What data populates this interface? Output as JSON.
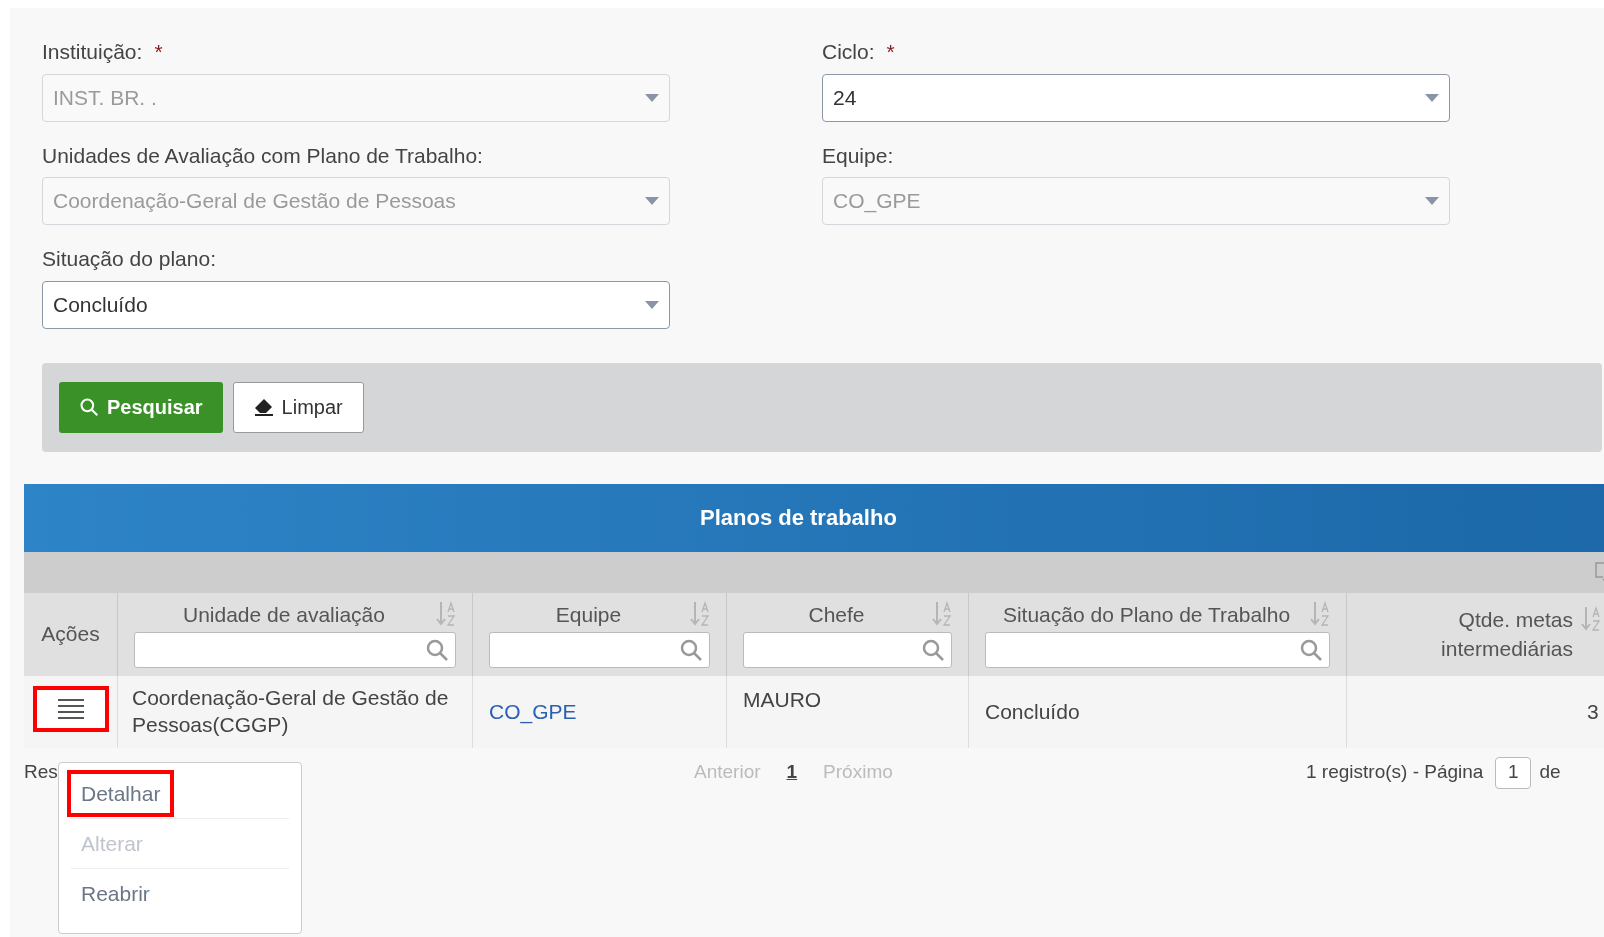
{
  "form": {
    "fields": [
      {
        "label": "Instituição:",
        "required_mark": "*",
        "value": "INST. BR. .",
        "disabled": true
      },
      {
        "label": "Ciclo:",
        "required_mark": "*",
        "value": "24",
        "disabled": false
      },
      {
        "label": "Unidades de Avaliação com Plano de Trabalho:",
        "value": "Coordenação-Geral de Gestão de Pessoas",
        "disabled": true
      },
      {
        "label": "Equipe:",
        "value": "CO_GPE",
        "disabled": true
      },
      {
        "label": "Situação do plano:",
        "value": "Concluído",
        "disabled": false
      }
    ],
    "buttons": [
      {
        "label": "Pesquisar",
        "kind": "primary"
      },
      {
        "label": "Limpar",
        "kind": "secondary"
      }
    ]
  },
  "table": {
    "title": "Planos de trabalho",
    "columns": [
      {
        "label": "Ações",
        "kind": "plain"
      },
      {
        "label": "Unidade de avaliação",
        "kind": "filter"
      },
      {
        "label": "Equipe",
        "kind": "filter"
      },
      {
        "label": "Chefe",
        "kind": "filter"
      },
      {
        "label": "Situação do Plano de Trabalho",
        "kind": "filter"
      },
      {
        "label": "Qtde. metas intermediárias",
        "kind": "sort"
      }
    ],
    "rows": [
      {
        "actions_highlighted": true,
        "unidade": "Coordenação-Geral de Gestão de Pessoas(CGGP)",
        "equipe": "CO_GPE",
        "chefe": "MAURO",
        "situacao": "Concluído",
        "qtde": "3"
      }
    ],
    "action_menu": [
      {
        "label": "Detalhar",
        "disabled": false,
        "highlighted": true
      },
      {
        "label": "Alterar",
        "disabled": true,
        "highlighted": false
      },
      {
        "label": "Reabrir",
        "disabled": false,
        "highlighted": false
      }
    ],
    "footer": {
      "summary": "Res",
      "pagination": [
        {
          "label": "Anterior",
          "kind": "nav",
          "disabled": true
        },
        {
          "label": "1",
          "kind": "page",
          "selected": true
        },
        {
          "label": "Próximo",
          "kind": "nav",
          "disabled": true
        }
      ],
      "records": "1 registro(s) - Página",
      "page_value": "1",
      "of": "de"
    }
  }
}
